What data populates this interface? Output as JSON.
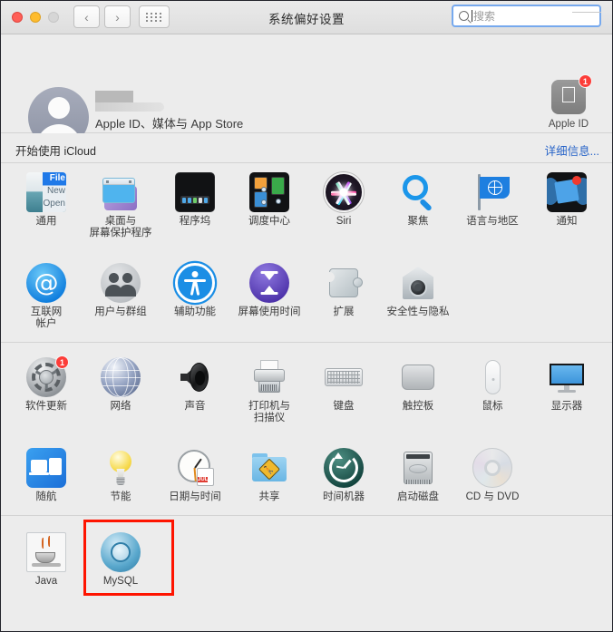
{
  "window": {
    "title": "系统偏好设置",
    "traffic_lights": [
      "close",
      "minimize",
      "maximize"
    ],
    "nav_back": "‹",
    "nav_forward": "›",
    "grid_button": "show-all-icon"
  },
  "search": {
    "placeholder": "搜索",
    "value": "",
    "icon": "search-icon"
  },
  "account": {
    "name_redacted": true,
    "subtitle": "Apple ID、媒体与 App Store",
    "apple_id_tile": {
      "label": "Apple ID",
      "badge": "1",
      "icon": "apple-logo-icon"
    }
  },
  "icloud": {
    "text": "开始使用 iCloud",
    "link": "详细信息..."
  },
  "colors": {
    "accent_link": "#2864c8",
    "badge_red": "#fc3d39",
    "selection_red": "#fe1400",
    "window_bg": "#ececec",
    "focus_ring": "#76a9ee"
  },
  "sections": [
    {
      "name": "section-1",
      "rows": [
        [
          {
            "icon": "general-icon",
            "label": "通用"
          },
          {
            "icon": "desktop-screensaver-icon",
            "label": "桌面与\n屏幕保护程序"
          },
          {
            "icon": "dock-icon",
            "label": "程序坞"
          },
          {
            "icon": "mission-control-icon",
            "label": "调度中心"
          },
          {
            "icon": "siri-icon",
            "label": "Siri"
          },
          {
            "icon": "spotlight-icon",
            "label": "聚焦"
          },
          {
            "icon": "language-region-icon",
            "label": "语言与地区"
          },
          {
            "icon": "notifications-icon",
            "label": "通知"
          }
        ],
        [
          {
            "icon": "internet-accounts-icon",
            "label": "互联网\n帐户"
          },
          {
            "icon": "users-groups-icon",
            "label": "用户与群组"
          },
          {
            "icon": "accessibility-icon",
            "label": "辅助功能"
          },
          {
            "icon": "screen-time-icon",
            "label": "屏幕使用时间"
          },
          {
            "icon": "extensions-icon",
            "label": "扩展"
          },
          {
            "icon": "security-privacy-icon",
            "label": "安全性与隐私"
          }
        ]
      ]
    },
    {
      "name": "section-2",
      "rows": [
        [
          {
            "icon": "software-update-icon",
            "label": "软件更新",
            "badge": "1"
          },
          {
            "icon": "network-icon",
            "label": "网络"
          },
          {
            "icon": "sound-icon",
            "label": "声音"
          },
          {
            "icon": "printers-scanners-icon",
            "label": "打印机与\n扫描仪"
          },
          {
            "icon": "keyboard-icon",
            "label": "键盘"
          },
          {
            "icon": "trackpad-icon",
            "label": "触控板"
          },
          {
            "icon": "mouse-icon",
            "label": "鼠标"
          },
          {
            "icon": "displays-icon",
            "label": "显示器"
          }
        ],
        [
          {
            "icon": "sidecar-icon",
            "label": "随航"
          },
          {
            "icon": "energy-saver-icon",
            "label": "节能"
          },
          {
            "icon": "date-time-icon",
            "label": "日期与时间",
            "calendar_month": "JUL",
            "calendar_day": "18"
          },
          {
            "icon": "sharing-icon",
            "label": "共享"
          },
          {
            "icon": "time-machine-icon",
            "label": "时间机器"
          },
          {
            "icon": "startup-disk-icon",
            "label": "启动磁盘"
          },
          {
            "icon": "cd-dvd-icon",
            "label": "CD 与 DVD"
          }
        ]
      ]
    },
    {
      "name": "section-3-third-party",
      "rows": [
        [
          {
            "icon": "java-icon",
            "label": "Java"
          },
          {
            "icon": "mysql-icon",
            "label": "MySQL",
            "selected": true
          }
        ]
      ]
    }
  ]
}
